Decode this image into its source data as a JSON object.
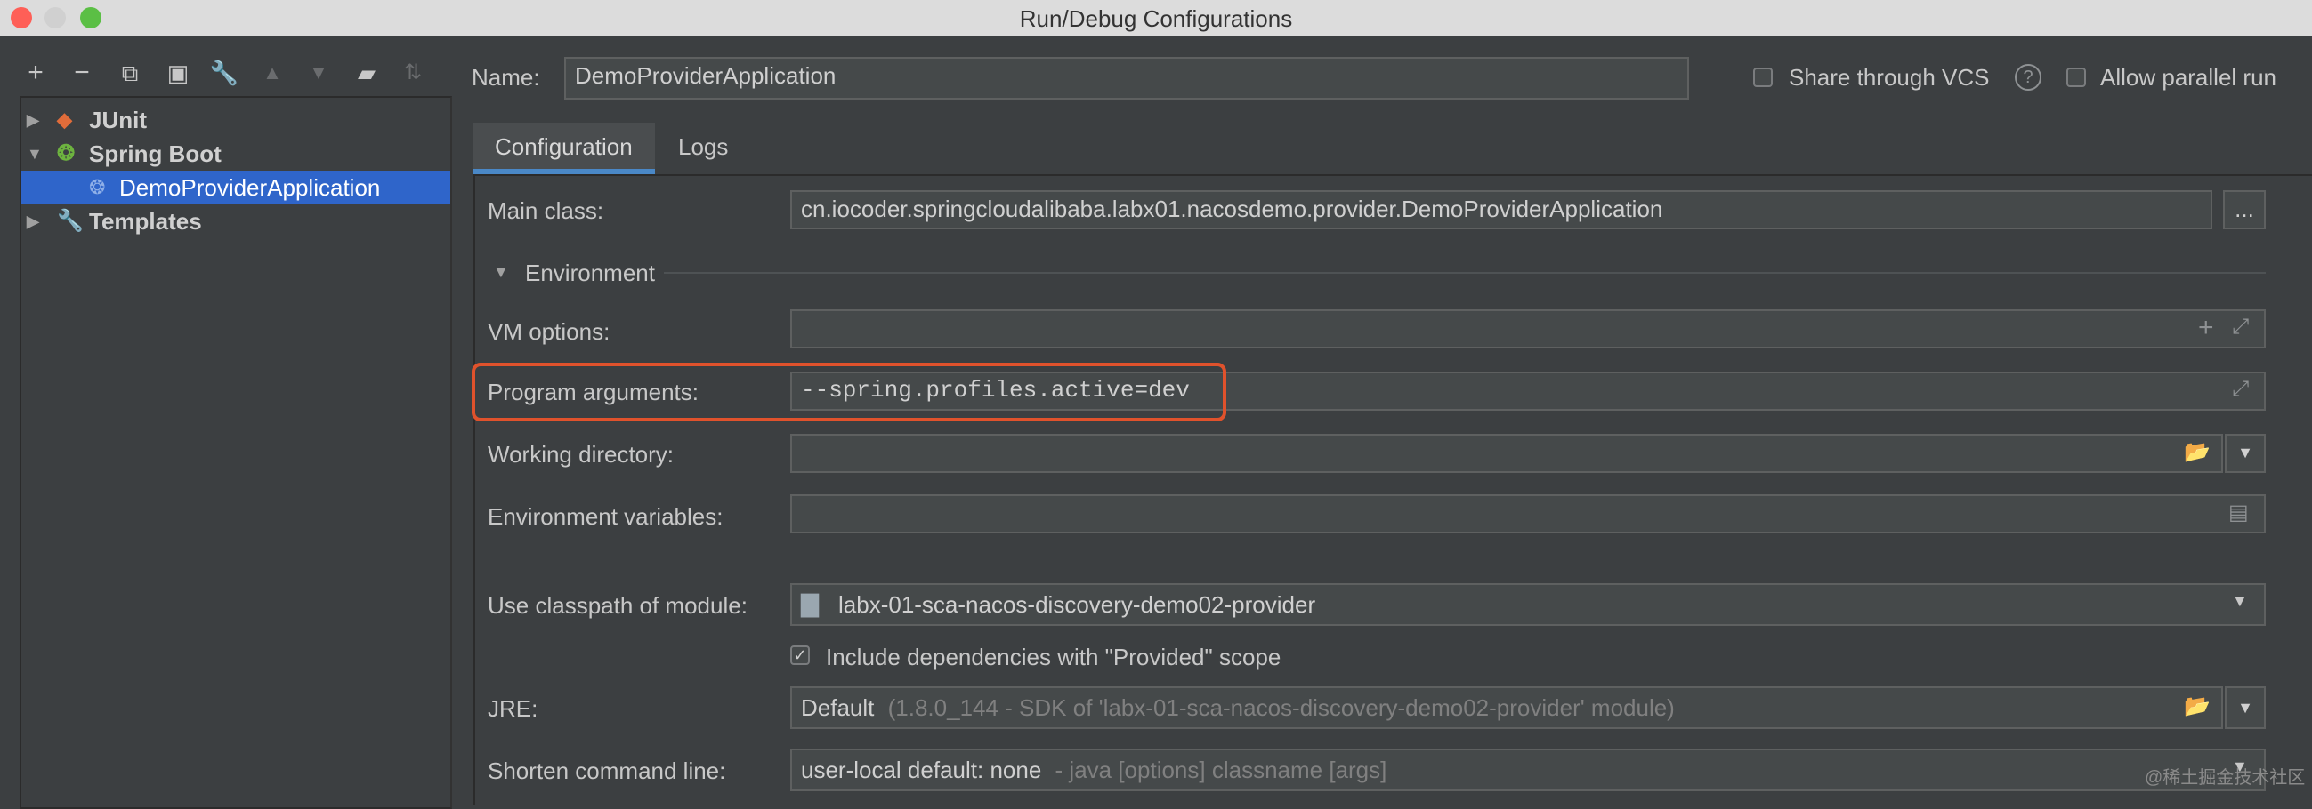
{
  "window": {
    "title": "Run/Debug Configurations"
  },
  "toolbar": {
    "buttons": [
      "add-icon",
      "remove-icon",
      "copy-icon",
      "save-icon",
      "wrench-icon",
      "arrow-up-icon",
      "arrow-down-icon",
      "new-folder-icon",
      "sort-icon"
    ]
  },
  "tree": {
    "items": [
      {
        "label": "JUnit"
      },
      {
        "label": "Spring Boot"
      },
      {
        "label": "DemoProviderApplication"
      },
      {
        "label": "Templates"
      }
    ]
  },
  "header": {
    "name_label": "Name:",
    "name_value": "DemoProviderApplication",
    "share_vcs": "Share through VCS",
    "allow_parallel": "Allow parallel run"
  },
  "tabs": [
    {
      "label": "Configuration"
    },
    {
      "label": "Logs"
    }
  ],
  "form": {
    "main_class_label": "Main class:",
    "main_class_value": "cn.iocoder.springcloudalibaba.labx01.nacosdemo.provider.DemoProviderApplication",
    "browse_label": "...",
    "environment_label": "Environment",
    "vm_options_label": "VM options:",
    "vm_options_value": "",
    "program_args_label": "Program arguments:",
    "program_args_value": "--spring.profiles.active=dev",
    "working_dir_label": "Working directory:",
    "working_dir_value": "",
    "env_vars_label": "Environment variables:",
    "env_vars_value": "",
    "classpath_label": "Use classpath of module:",
    "classpath_value": "labx-01-sca-nacos-discovery-demo02-provider",
    "include_deps_label": "Include dependencies with \"Provided\" scope",
    "jre_label": "JRE:",
    "jre_value": "Default",
    "jre_detail": "(1.8.0_144 - SDK of 'labx-01-sca-nacos-discovery-demo02-provider' module)",
    "shorten_label": "Shorten command line:",
    "shorten_value": "user-local default: none",
    "shorten_detail": "- java [options] classname [args]"
  },
  "watermark": "@稀土掘金技术社区",
  "colors": {
    "highlight_box": "#e0522c",
    "selection": "#2f65ca",
    "tab_underline": "#4a88c7"
  }
}
